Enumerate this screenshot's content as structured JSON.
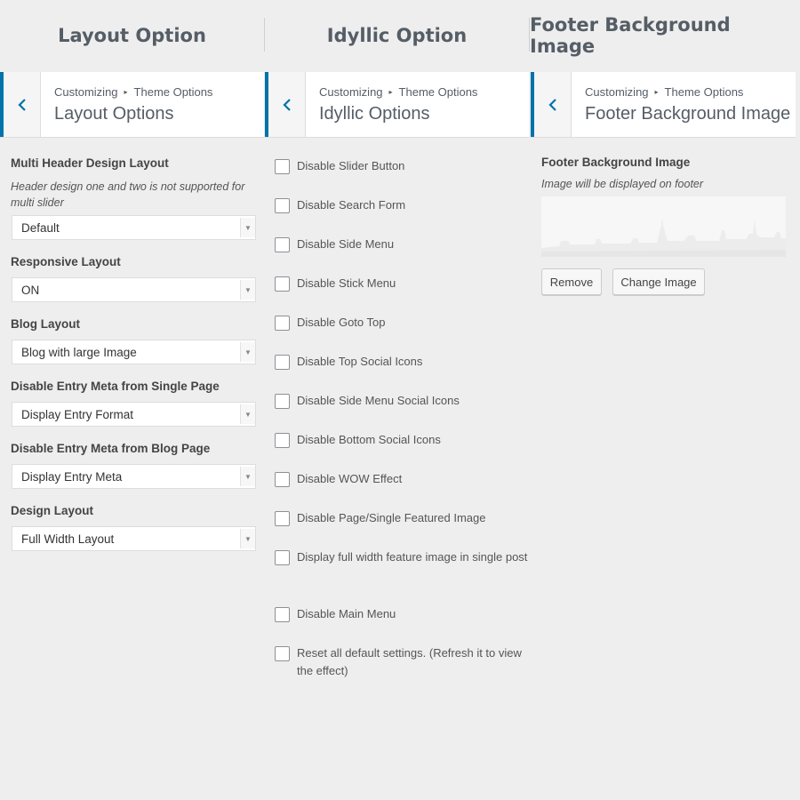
{
  "columns": [
    {
      "title": "Layout Option",
      "breadcrumb_root": "Customizing",
      "breadcrumb_section": "Theme Options",
      "panel_title": "Layout Options"
    },
    {
      "title": "Idyllic Option",
      "breadcrumb_root": "Customizing",
      "breadcrumb_section": "Theme Options",
      "panel_title": "Idyllic Options"
    },
    {
      "title": "Footer Background Image",
      "breadcrumb_root": "Customizing",
      "breadcrumb_section": "Theme Options",
      "panel_title": "Footer Background Image"
    }
  ],
  "layout_options": {
    "multi_header": {
      "label": "Multi Header Design Layout",
      "description": "Header design one and two is not supported for multi slider",
      "value": "Default"
    },
    "responsive": {
      "label": "Responsive Layout",
      "value": "ON"
    },
    "blog_layout": {
      "label": "Blog Layout",
      "value": "Blog with large Image"
    },
    "entry_meta_single": {
      "label": "Disable Entry Meta from Single Page",
      "value": "Display Entry Format"
    },
    "entry_meta_blog": {
      "label": "Disable Entry Meta from Blog Page",
      "value": "Display Entry Meta"
    },
    "design_layout": {
      "label": "Design Layout",
      "value": "Full Width Layout"
    }
  },
  "idyllic_options": {
    "checkboxes": [
      {
        "label": "Disable Slider Button",
        "checked": false
      },
      {
        "label": "Disable Search Form",
        "checked": false
      },
      {
        "label": "Disable Side Menu",
        "checked": false
      },
      {
        "label": "Disable Stick Menu",
        "checked": false
      },
      {
        "label": "Disable Goto Top",
        "checked": false
      },
      {
        "label": "Disable Top Social Icons",
        "checked": false
      },
      {
        "label": "Disable Side Menu Social Icons",
        "checked": false
      },
      {
        "label": "Disable Bottom Social Icons",
        "checked": false
      },
      {
        "label": "Disable WOW Effect",
        "checked": false
      },
      {
        "label": "Disable Page/Single Featured Image",
        "checked": false
      },
      {
        "label": "Display full width feature image in single post",
        "checked": false
      },
      {
        "label": "Disable Main Menu",
        "checked": false
      },
      {
        "label": "Reset all default settings. (Refresh it to view the effect)",
        "checked": false
      }
    ]
  },
  "footer_image": {
    "label": "Footer Background Image",
    "description": "Image will be displayed on footer",
    "remove_label": "Remove",
    "change_label": "Change Image"
  },
  "icons": {
    "back": "chevron-left-icon",
    "breadcrumb_separator": "triangle-right-icon",
    "select_arrow": "chevron-down-icon"
  },
  "colors": {
    "accent": "#0073aa",
    "background": "#eeeeee",
    "panel": "#ffffff"
  }
}
